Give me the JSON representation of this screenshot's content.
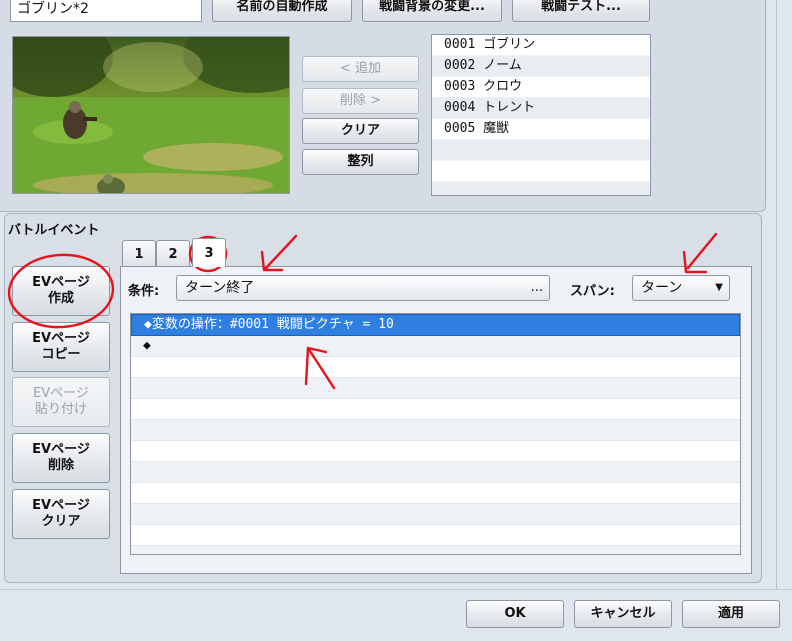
{
  "troop": {
    "name": "ゴブリン*2",
    "auto_name_label": "名前の自動作成",
    "change_bg_label": "戦闘背景の変更...",
    "battle_test_label": "戦闘テスト..."
  },
  "enemy_actions": {
    "add_label": "< 追加",
    "remove_label": "削除 >",
    "clear_label": "クリア",
    "align_label": "整列"
  },
  "enemies": [
    {
      "label": "0001 ゴブリン"
    },
    {
      "label": "0002 ノーム"
    },
    {
      "label": "0003 クロウ"
    },
    {
      "label": "0004 トレント"
    },
    {
      "label": "0005 魔獣"
    }
  ],
  "battle_event": {
    "title": "バトルイベント",
    "side_buttons": {
      "new_page": [
        "EVページ",
        "作成"
      ],
      "copy_page": [
        "EVページ",
        "コピー"
      ],
      "paste_page": [
        "EVページ",
        "貼り付け"
      ],
      "delete_page": [
        "EVページ",
        "削除"
      ],
      "clear_page": [
        "EVページ",
        "クリア"
      ]
    },
    "tabs": [
      "1",
      "2",
      "3"
    ],
    "active_tab": "3",
    "condition_label": "条件:",
    "condition_value": "ターン終了",
    "condition_more": "...",
    "span_label": "スパン:",
    "span_value": "ターン",
    "commands": [
      "◆変数の操作：#0001 戦闘ピクチャ = 10",
      "◆"
    ]
  },
  "dialog": {
    "ok_label": "OK",
    "cancel_label": "キャンセル",
    "apply_label": "適用"
  },
  "colors": {
    "selection": "#2f7fe0",
    "annotation": "#e8121c"
  }
}
